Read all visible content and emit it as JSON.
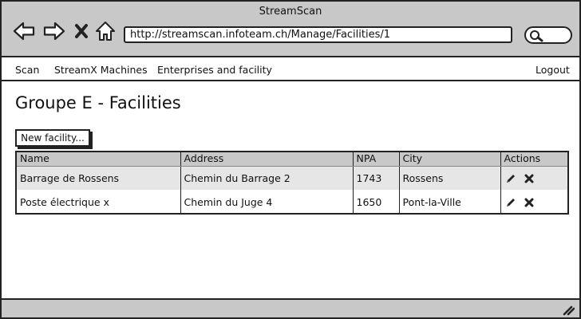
{
  "window": {
    "title": "StreamScan"
  },
  "browser": {
    "url": "http://streamscan.infoteam.ch/Manage/Facilities/1"
  },
  "menu": {
    "items": [
      "Scan",
      "StreamX Machines",
      "Enterprises and facility"
    ],
    "logout": "Logout"
  },
  "page": {
    "title": "Groupe E - Facilities",
    "new_button": "New facility..."
  },
  "table": {
    "headers": [
      "Name",
      "Address",
      "NPA",
      "City",
      "Actions"
    ],
    "rows": [
      {
        "name": "Barrage de Rossens",
        "address": "Chemin du Barrage 2",
        "npa": "1743",
        "city": "Rossens"
      },
      {
        "name": "Poste électrique x",
        "address": "Chemin du Juge 4",
        "npa": "1650",
        "city": "Pont-la-Ville"
      }
    ]
  },
  "icons": {
    "back": "back-arrow-icon",
    "forward": "forward-arrow-icon",
    "stop": "close-icon",
    "home": "home-icon",
    "search": "search-icon",
    "edit": "pencil-icon",
    "delete": "delete-icon",
    "resize": "resize-grip-icon"
  }
}
